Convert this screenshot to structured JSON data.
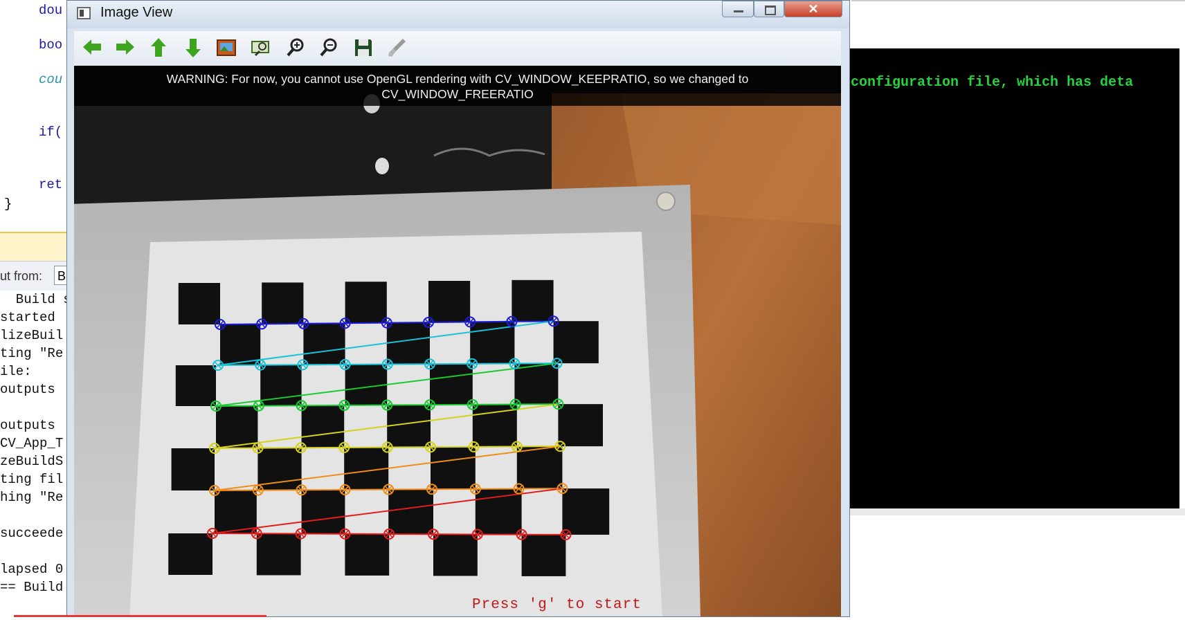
{
  "editor": {
    "lines": [
      {
        "text": "dou",
        "cls": "kw"
      },
      {
        "text": "boo",
        "cls": "kw"
      },
      {
        "text": "cou",
        "cls": "id"
      },
      {
        "text": "if(",
        "cls": "kw"
      },
      {
        "text": "ret",
        "cls": "kw"
      },
      {
        "text": "}",
        "cls": ""
      }
    ]
  },
  "output": {
    "from_label": "ut from:",
    "from_value": "B",
    "lines": [
      "  Build s",
      "started",
      "lizeBuil",
      "ting \"Re",
      "ile:",
      "outputs",
      "",
      "outputs",
      "CV_App_T",
      "zeBuildS",
      "ting fil",
      "hing \"Re",
      "",
      "succeede",
      "",
      "lapsed 0",
      "== Build"
    ]
  },
  "console": {
    "text": "configuration file, which has deta"
  },
  "window": {
    "title": "Image View",
    "close_glyph": "✕",
    "toolbar": [
      {
        "name": "pan-left-button",
        "icon": "arrow-left-icon"
      },
      {
        "name": "pan-right-button",
        "icon": "arrow-right-icon"
      },
      {
        "name": "pan-up-button",
        "icon": "arrow-up-icon"
      },
      {
        "name": "pan-down-button",
        "icon": "arrow-down-icon"
      },
      {
        "name": "zoom-original-button",
        "icon": "image-icon"
      },
      {
        "name": "zoom-fit-button",
        "icon": "zoom-area-icon"
      },
      {
        "name": "zoom-in-button",
        "icon": "zoom-in-icon"
      },
      {
        "name": "zoom-out-button",
        "icon": "zoom-out-icon"
      },
      {
        "name": "save-button",
        "icon": "save-icon"
      },
      {
        "name": "properties-button",
        "icon": "brush-icon"
      }
    ],
    "warning_line1": "WARNING: For now, you cannot use OpenGL rendering with CV_WINDOW_KEEPRATIO, so we changed to",
    "warning_line2": "CV_WINDOW_FREERATIO",
    "press_text": "Press 'g' to start"
  },
  "chessboard": {
    "colors": [
      "#1b1bd8",
      "#19c2d6",
      "#19c931",
      "#d6d11a",
      "#ef8d18",
      "#e01d1d"
    ]
  }
}
